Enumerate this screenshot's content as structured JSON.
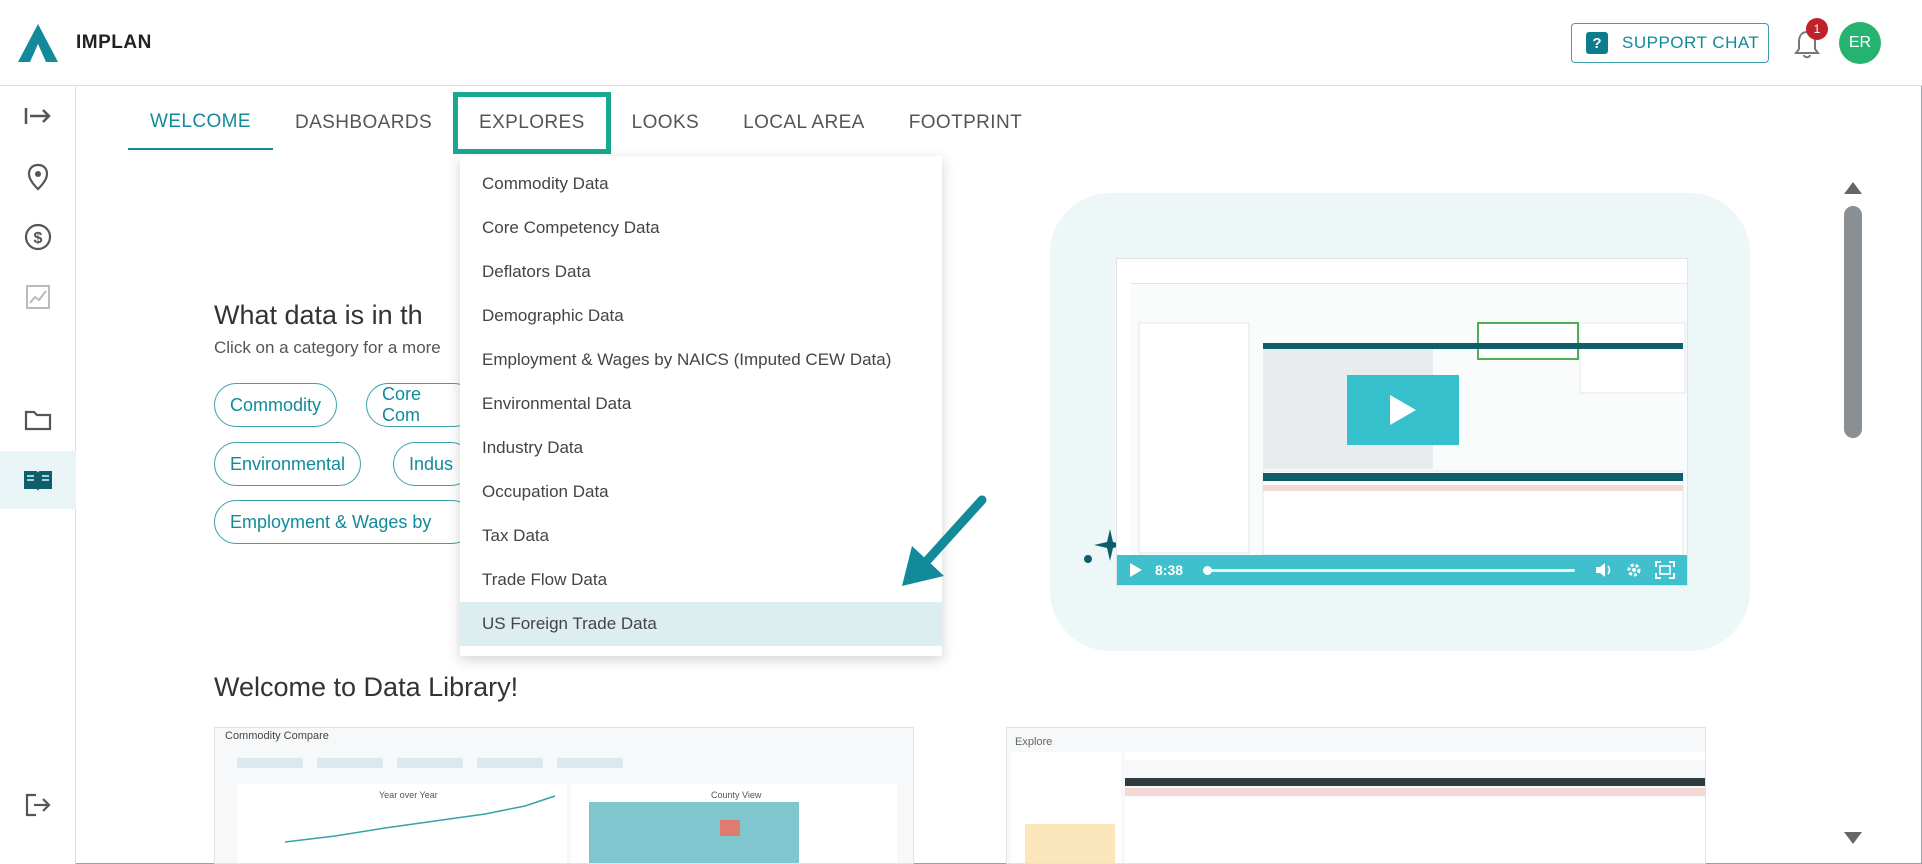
{
  "header": {
    "brand": "IMPLAN",
    "support_label": "SUPPORT CHAT",
    "notification_count": "1",
    "avatar_initials": "ER"
  },
  "tabs": [
    {
      "label": "WELCOME"
    },
    {
      "label": "DASHBOARDS"
    },
    {
      "label": "EXPLORES"
    },
    {
      "label": "LOOKS"
    },
    {
      "label": "LOCAL AREA"
    },
    {
      "label": "FOOTPRINT"
    }
  ],
  "explores_menu": [
    "Commodity Data",
    "Core Competency Data",
    "Deflators Data",
    "Demographic Data",
    "Employment & Wages by NAICS (Imputed CEW Data)",
    "Environmental Data",
    "Industry Data",
    "Occupation Data",
    "Tax Data",
    "Trade Flow Data",
    "US Foreign Trade Data"
  ],
  "welcome": {
    "heading_partial": "What data is in th",
    "subtext_partial": "Click on a category for a more",
    "pills": [
      "Commodity",
      "Core Com",
      "Environmental",
      "Indus",
      "Employment & Wages by"
    ],
    "library_title": "Welcome to Data Library!"
  },
  "video": {
    "duration": "8:38"
  },
  "previews": {
    "left_title": "Commodity Compare",
    "left_chart_title": "Year over Year",
    "left_map_title": "County View",
    "right_title": "Explore"
  },
  "colors": {
    "accent": "#128a99",
    "highlight_outline": "#17a98f",
    "badge": "#c0212b",
    "avatar": "#26b36f"
  }
}
